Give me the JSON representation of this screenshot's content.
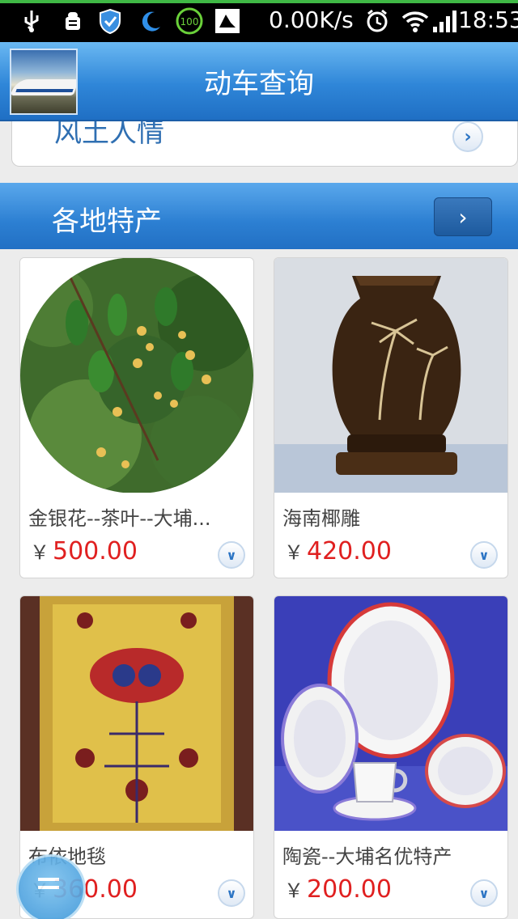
{
  "status_bar": {
    "net_speed": "0.00K/s",
    "time": "18:53",
    "battery_badge": "100",
    "icons": [
      "usb-icon",
      "android-debug-icon",
      "shield-icon",
      "moon-icon",
      "battery-circle-icon",
      "app-notification-icon",
      "alarm-icon",
      "wifi-icon",
      "signal-icon"
    ]
  },
  "header": {
    "title": "动车查询"
  },
  "folk_customs": {
    "title": "风土人情"
  },
  "specialties": {
    "title": "各地特产",
    "items": [
      {
        "name": "金银花--茶叶--大埔...",
        "currency": "￥",
        "price": "500.00"
      },
      {
        "name": "海南椰雕",
        "currency": "￥",
        "price": "420.00"
      },
      {
        "name": "布依地毯",
        "currency": "￥",
        "price": "360.00"
      },
      {
        "name": "陶瓷--大埔名优特产",
        "currency": "￥",
        "price": "200.00"
      }
    ]
  },
  "colors": {
    "header_blue": "#2f86d8",
    "price_red": "#e02020",
    "link_blue": "#2f6fb2"
  }
}
